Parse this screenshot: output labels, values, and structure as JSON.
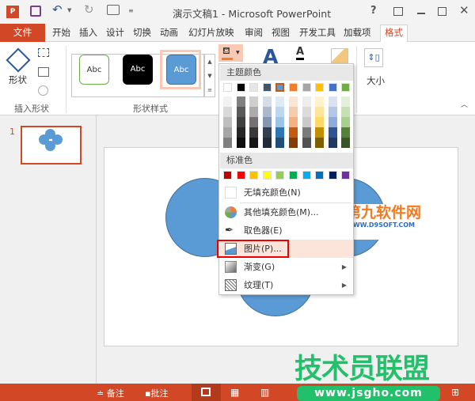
{
  "title": "演示文稿1 - Microsoft PowerPoint",
  "window_controls": {
    "help": "?"
  },
  "tabs": [
    "文件",
    "开始",
    "插入",
    "设计",
    "切换",
    "动画",
    "幻灯片放映",
    "审阅",
    "视图",
    "开发工具",
    "加载项",
    "格式"
  ],
  "ribbon": {
    "insert_shapes": {
      "shapes_label": "形状",
      "group_label": "插入形状"
    },
    "shape_styles": {
      "samples": [
        "Abc",
        "Abc",
        "Abc"
      ],
      "group_label": "形状样式"
    },
    "size": {
      "label": "大小"
    }
  },
  "fill_menu": {
    "theme_header": "主题颜色",
    "theme_colors": [
      "#ffffff",
      "#000000",
      "#e7e6e6",
      "#44546a",
      "#5b9bd5",
      "#ed7d31",
      "#a5a5a5",
      "#ffc000",
      "#4472c4",
      "#70ad47"
    ],
    "theme_shades": [
      [
        "#f2f2f2",
        "#d9d9d9",
        "#bfbfbf",
        "#a6a6a6",
        "#808080"
      ],
      [
        "#808080",
        "#595959",
        "#404040",
        "#262626",
        "#0d0d0d"
      ],
      [
        "#d0cece",
        "#aeabab",
        "#757171",
        "#3a3838",
        "#171616"
      ],
      [
        "#d6dce4",
        "#adb9ca",
        "#8496b0",
        "#333f4f",
        "#222a35"
      ],
      [
        "#deebf6",
        "#bdd7ee",
        "#9dc3e6",
        "#2e75b5",
        "#1f4e79"
      ],
      [
        "#fbe5d5",
        "#f7cbac",
        "#f4b183",
        "#c55a11",
        "#843c0b"
      ],
      [
        "#ededed",
        "#dbdbdb",
        "#c9c9c9",
        "#7b7b7b",
        "#525252"
      ],
      [
        "#fff2cc",
        "#fee599",
        "#ffd965",
        "#bf9000",
        "#7f6000"
      ],
      [
        "#dae3f3",
        "#b4c7e7",
        "#8faadc",
        "#2f5496",
        "#1f3864"
      ],
      [
        "#e2efd9",
        "#c5e0b3",
        "#a8d08d",
        "#538135",
        "#375623"
      ]
    ],
    "standard_header": "标准色",
    "standard_colors": [
      "#c00000",
      "#ff0000",
      "#ffc000",
      "#ffff00",
      "#92d050",
      "#00b050",
      "#00b0f0",
      "#0070c0",
      "#002060",
      "#7030a0"
    ],
    "items": [
      {
        "label": "无填充颜色(N)"
      },
      {
        "label": "其他填充颜色(M)..."
      },
      {
        "label": "取色器(E)"
      },
      {
        "label": "图片(P)..."
      },
      {
        "label": "渐变(G)"
      },
      {
        "label": "纹理(T)"
      }
    ]
  },
  "thumbnail": {
    "number": "1"
  },
  "watermarks": {
    "d9_top": "第九软件网",
    "d9_bottom": "WWW.D9SOFT.COM",
    "jsgho_top": "技术员联盟",
    "jsgho_url": "www.jsgho.com"
  },
  "statusbar": {
    "notes": "备注",
    "comments": "批注"
  },
  "colors": {
    "accent": "#d24726",
    "selected_tab": "#d24726",
    "shape_fill": "#5b9bd5"
  }
}
